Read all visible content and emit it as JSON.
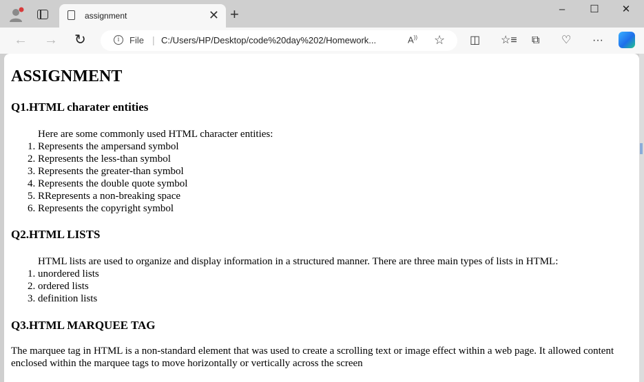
{
  "browser": {
    "tab_title": "assignment",
    "address_scheme": "File",
    "address_url": "C:/Users/HP/Desktop/code%20day%202/Homework...",
    "window_controls": [
      "minimize-icon",
      "maximize-icon",
      "close-icon"
    ]
  },
  "page": {
    "heading": "ASSIGNMENT",
    "q1": {
      "title": "Q1.HTML charater entities",
      "intro": "Here are some commonly used HTML character entities:",
      "items": [
        "Represents the ampersand symbol",
        "Represents the less-than symbol",
        "Represents the greater-than symbol",
        "Represents the double quote symbol",
        "RRepresents a non-breaking space",
        "Represents the copyright symbol"
      ]
    },
    "q2": {
      "title": "Q2.HTML LISTS",
      "intro": "HTML lists are used to organize and display information in a structured manner. There are three main types of lists in HTML:",
      "items": [
        "unordered lists",
        "ordered lists",
        "definition lists"
      ]
    },
    "q3": {
      "title": "Q3.HTML MARQUEE TAG",
      "body": "The marquee tag in HTML is a non-standard element that was used to create a scrolling text or image effect within a web page. It allowed content enclosed within the marquee tags to move horizontally or vertically across the screen"
    }
  }
}
